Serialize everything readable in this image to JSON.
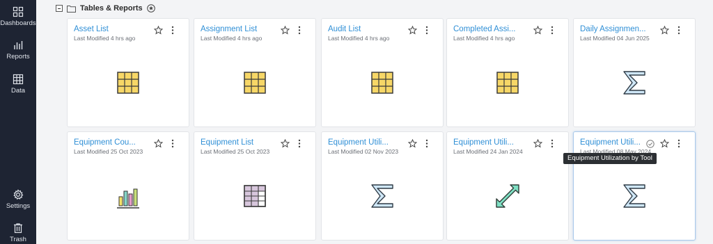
{
  "sidebar": {
    "items": [
      {
        "label": "Dashboards",
        "icon": "dashboards-icon"
      },
      {
        "label": "Reports",
        "icon": "reports-icon"
      },
      {
        "label": "Data",
        "icon": "data-icon"
      },
      {
        "label": "Settings",
        "icon": "gear-icon"
      },
      {
        "label": "Trash",
        "icon": "trash-icon"
      }
    ]
  },
  "section": {
    "title": "Tables & Reports"
  },
  "cards": [
    {
      "title": "Asset List",
      "modified": "Last Modified 4 hrs ago",
      "icon": "table-icon"
    },
    {
      "title": "Assignment List",
      "modified": "Last Modified 4 hrs ago",
      "icon": "table-icon"
    },
    {
      "title": "Audit List",
      "modified": "Last Modified 4 hrs ago",
      "icon": "table-icon"
    },
    {
      "title": "Completed Assi...",
      "modified": "Last Modified 4 hrs ago",
      "icon": "table-icon"
    },
    {
      "title": "Daily Assignmen...",
      "modified": "Last Modified 04 Jun 2025",
      "icon": "sigma-icon"
    },
    {
      "title": "Equipment Cou...",
      "modified": "Last Modified 25 Oct 2023",
      "icon": "bar-chart-icon"
    },
    {
      "title": "Equipment List",
      "modified": "Last Modified 25 Oct 2023",
      "icon": "pivot-table-icon"
    },
    {
      "title": "Equipment Utili...",
      "modified": "Last Modified 02 Nov 2023",
      "icon": "sigma-icon"
    },
    {
      "title": "Equipment Utili...",
      "modified": "Last Modified 24 Jan 2024",
      "icon": "expand-arrows-icon"
    },
    {
      "title": "Equipment Utili...",
      "modified": "Last Modified 08 May 2024",
      "icon": "sigma-icon"
    }
  ],
  "tooltip": {
    "text": "Equipment Utilization by Tool"
  },
  "colors": {
    "sidebar_bg": "#1e2433",
    "link": "#2f8fd6",
    "table_fill": "#f7d767",
    "sigma_fill": "#cfe7f7",
    "arrow_fill": "#7fe0c4",
    "pivot_fill": "#d7c6dc"
  }
}
